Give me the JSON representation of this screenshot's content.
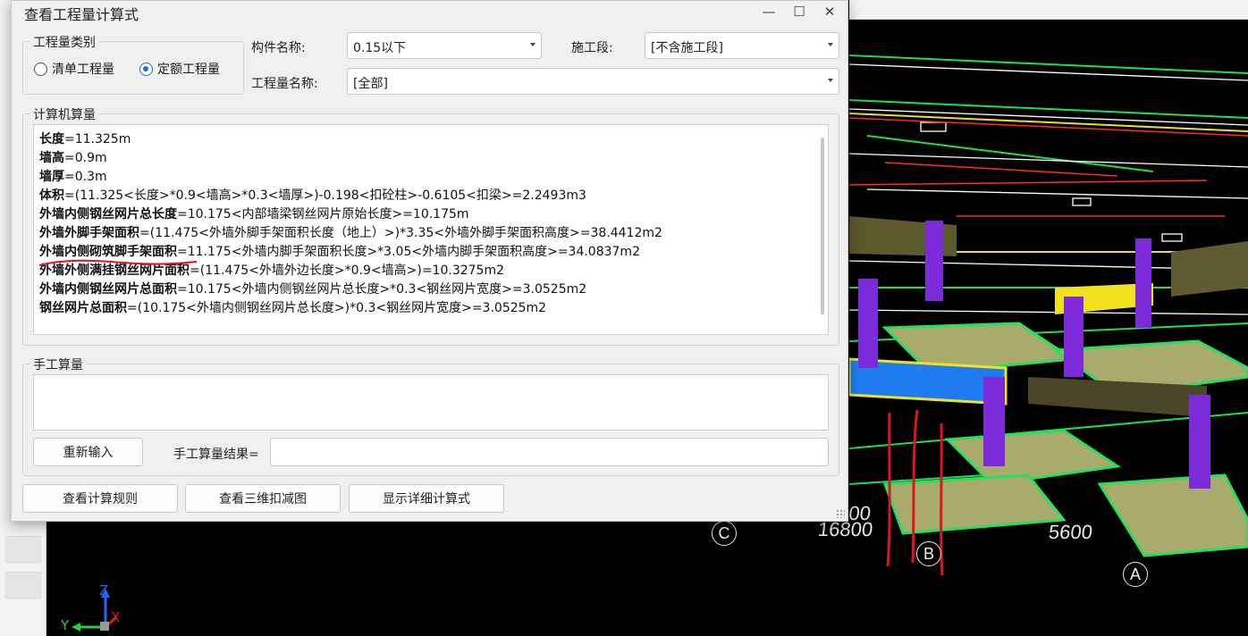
{
  "dialog": {
    "title": "查看工程量计算式",
    "minimize_glyph": "—",
    "maximize_glyph": "☐",
    "close_glyph": "✕",
    "quantity_type": {
      "legend": "工程量类别",
      "options": [
        "清单工程量",
        "定额工程量"
      ],
      "selected": "定额工程量"
    },
    "component_label": "构件名称:",
    "component_value": "0.15以下",
    "stage_label": "施工段:",
    "stage_value": "[不含施工段]",
    "quantity_name_label": "工程量名称:",
    "quantity_name_value": "[全部]",
    "computer_calc": {
      "legend": "计算机算量",
      "lines": [
        {
          "name": "长度",
          "formula": "=11.325m"
        },
        {
          "name": "墙高",
          "formula": "=0.9m"
        },
        {
          "name": "墙厚",
          "formula": "=0.3m"
        },
        {
          "name": "体积",
          "formula": "=(11.325<长度>*0.9<墙高>*0.3<墙厚>)-0.198<扣砼柱>-0.6105<扣梁>=2.2493m3"
        },
        {
          "name": "外墙内侧钢丝网片总长度",
          "formula": "=10.175<内部墙梁钢丝网片原始长度>=10.175m"
        },
        {
          "name": "外墙外脚手架面积",
          "formula": "=(11.475<外墙外脚手架面积长度（地上）>)*3.35<外墙外脚手架面积高度>=38.4412m2"
        },
        {
          "name": "外墙内侧砌筑脚手架面积",
          "formula": "=11.175<外墙内脚手架面积长度>*3.05<外墙内脚手架面积高度>=34.0837m2"
        },
        {
          "name": "外墙外侧满挂钢丝网片面积",
          "formula": "=(11.475<外墙外边长度>*0.9<墙高>)=10.3275m2"
        },
        {
          "name": "外墙内侧钢丝网片总面积",
          "formula": "=10.175<外墙内侧钢丝网片总长度>*0.3<钢丝网片宽度>=3.0525m2"
        },
        {
          "name": "钢丝网片总面积",
          "formula": "=(10.175<外墙内侧钢丝网片总长度>)*0.3<钢丝网片宽度>=3.0525m2"
        }
      ]
    },
    "manual_calc": {
      "legend": "手工算量",
      "reenter_button": "重新输入",
      "result_label": "手工算量结果="
    },
    "footer_buttons": [
      "查看计算规则",
      "查看三维扣减图",
      "显示详细计算式"
    ]
  },
  "viewport": {
    "dimension_labels": [
      "5600",
      "16800",
      "5600"
    ],
    "axis_bubbles": [
      "C",
      "B",
      "A"
    ],
    "gizmo_axes": [
      "Z",
      "Y",
      "X"
    ]
  },
  "colors": {
    "accent": "#1f6fd1",
    "annotation_red": "#e0141e",
    "column_purple": "#7d2bd9",
    "footing_olive": "#a8aa6a",
    "grid_green": "#19d94f",
    "beam_blue": "#1e7cf0"
  }
}
